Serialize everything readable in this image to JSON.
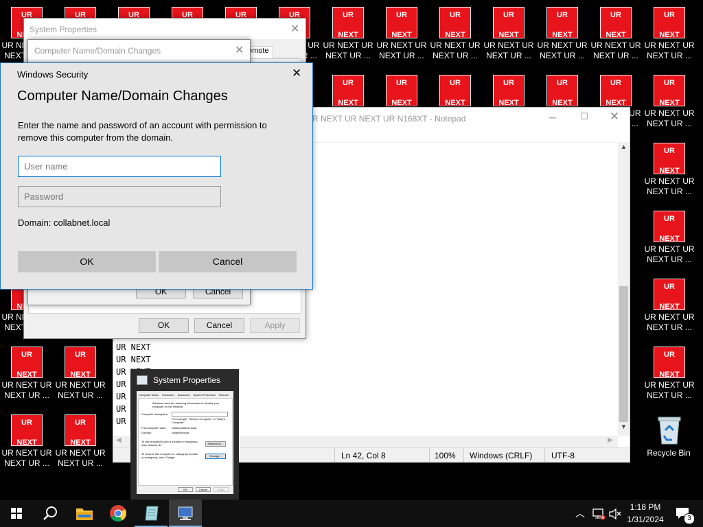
{
  "desktop": {
    "icon_top": "UR",
    "icon_bottom": "NEXT",
    "icon_label_line1": "UR NEXT UR",
    "icon_label_line2": "NEXT UR ...",
    "recycle_bin": "Recycle Bin",
    "partial_top_labels": {
      "left_col1_a": "UR",
      "left_col1_b": "NEXT",
      "mid_col_a": "UR",
      "mid_col_b": "NEXT"
    }
  },
  "notepad": {
    "title": "R NEXT UR NEXT UR N168XT - Notepad",
    "lines": [
      "UR  NEXT",
      "UR  NEXT",
      "UR  NEXT",
      "UR  NEXT",
      "UR  NEXT",
      "UR  NEXT",
      "UR  NEXT"
    ],
    "status": {
      "position": "Ln 42, Col 8",
      "zoom": "100%",
      "eol": "Windows (CRLF)",
      "encoding": "UTF-8"
    }
  },
  "system_properties": {
    "title": "System Properties",
    "tab_remote": "emote",
    "ok": "OK",
    "cancel": "Cancel",
    "apply": "Apply"
  },
  "domain_changes": {
    "title": "Computer Name/Domain Changes",
    "ok": "OK",
    "cancel": "Cancel"
  },
  "security": {
    "window_title": "Windows Security",
    "heading": "Computer Name/Domain Changes",
    "message": "Enter the name and password of an account with permission to remove this computer from the domain.",
    "username_placeholder": "User name",
    "password_placeholder": "Password",
    "domain": "Domain: collabnet.local",
    "ok": "OK",
    "cancel": "Cancel"
  },
  "taskbar_preview": {
    "title": "System Properties",
    "tabs": [
      "Computer Name",
      "Hardware",
      "Advanced",
      "System Protection",
      "Remote"
    ],
    "desc": "Windows uses the following information to identify your computer on the network.",
    "computer_description_label": "Computer description:",
    "example": "For example: \"Kitchen Computer\" or \"Mary's Computer\".",
    "full_name_label": "Full computer name:",
    "full_name_value": "N168.collabnet.local",
    "domain_label": "Domain:",
    "domain_value": "collabnet.local",
    "join_text": "To use a wizard to join a domain or workgroup, click Network ID.",
    "network_id": "Network ID...",
    "rename_text": "To rename this computer or change its domain or workgroup, click Change.",
    "change": "Change...",
    "ok": "OK",
    "cancel": "Cancel",
    "apply": "Apply"
  },
  "clock": {
    "time": "1:18 PM",
    "date": "1/31/2024"
  },
  "notifications_count": "3",
  "colors": {
    "icon_red": "#e8141b",
    "accent": "#0078d7",
    "taskbar": "#101010"
  }
}
